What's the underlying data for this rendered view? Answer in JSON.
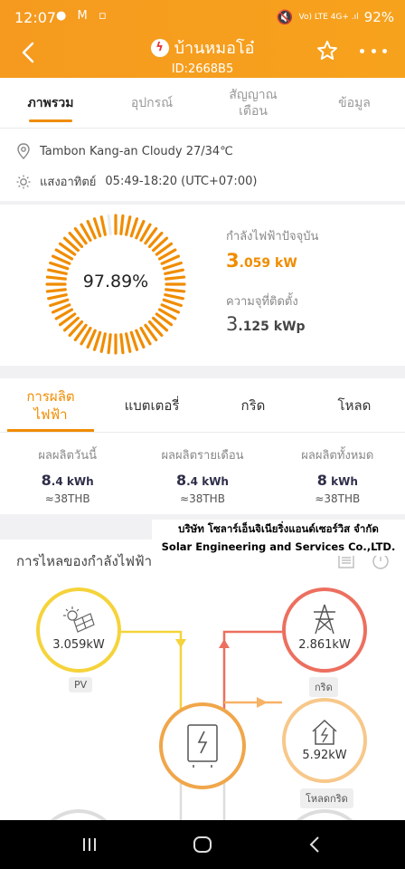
{
  "status": {
    "time": "12:07",
    "left_icons": "●  M  ▫",
    "right_text": "Vo) LTE 4G+ .ıl",
    "battery": "92%"
  },
  "header": {
    "title": "บ้านหมอโอ๋",
    "subtitle": "ID:2668B5"
  },
  "top_tabs": [
    {
      "label": "ภาพรวม",
      "active": true
    },
    {
      "label": "อุปกรณ์",
      "active": false
    },
    {
      "label": "สัญญาณ\nเตือน",
      "active": false
    },
    {
      "label": "ข้อมูล",
      "active": false
    }
  ],
  "info": {
    "location": "Tambon Kang-an Cloudy 27/34℃",
    "sun_label": "แสงอาทิตย์",
    "sun_time": "05:49-18:20 (UTC+07:00)"
  },
  "gauge": {
    "percent_text": "97.89%",
    "percent_value": 97.89,
    "current_power_label": "กำลังไฟฟ้าปัจจุบัน",
    "current_power_int": "3",
    "current_power_frac": ".059 kW",
    "capacity_label": "ความจุที่ติดตั้ง",
    "capacity_int": "3",
    "capacity_frac": ".125 kWp",
    "accent": "#f08c00"
  },
  "sub_tabs": [
    {
      "label": "การผลิต\nไฟฟ้า",
      "active": true
    },
    {
      "label": "แบตเตอรี่",
      "active": false
    },
    {
      "label": "กริด",
      "active": false
    },
    {
      "label": "โหลด",
      "active": false
    }
  ],
  "production": [
    {
      "label": "ผลผลิตวันนี้",
      "int": "8",
      "frac": ".4 kWh",
      "money": "≈38THB"
    },
    {
      "label": "ผลผลิตรายเดือน",
      "int": "8",
      "frac": ".4 kWh",
      "money": "≈38THB"
    },
    {
      "label": "ผลผลิตทั้งหมด",
      "int": "8",
      "frac": " kWh",
      "money": "≈38THB"
    }
  ],
  "company": {
    "line1": "บริษัท โซลาร์เอ็นจิเนียริ่งแอนด์เซอร์วิส จำกัด",
    "line2": "Solar Engineering and Services Co.,LTD."
  },
  "flow": {
    "title": "การไหลของกำลังไฟฟ้า",
    "pv_value": "3.059kW",
    "pv_label": "PV",
    "grid_value": "2.861kW",
    "grid_label": "กริด",
    "load_value": "5.92kW",
    "load_label": "โหลดกริด",
    "colors": {
      "pv": "#f5d33a",
      "grid": "#ec6f5f",
      "load": "#f7c88a",
      "inverter": "#f0a64a"
    }
  }
}
